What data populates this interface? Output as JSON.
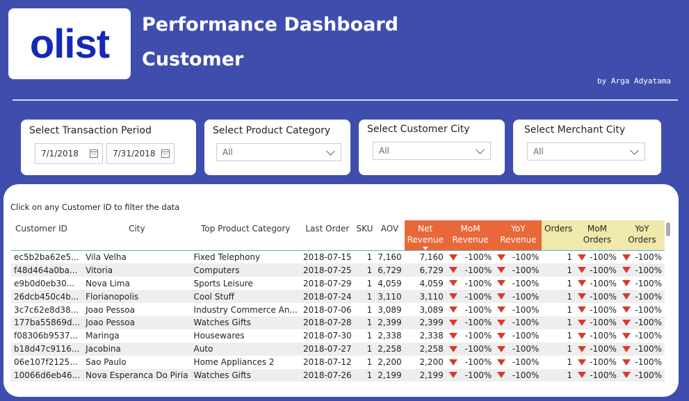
{
  "header": {
    "logo": "olist",
    "title": "Performance Dashboard",
    "subtitle": "Customer",
    "author": "by Arga Adyatama"
  },
  "filters": {
    "period": {
      "title": "Select Transaction Period",
      "start": "7/1/2018",
      "end": "7/31/2018"
    },
    "product_category": {
      "title": "Select Product Category",
      "value": "All"
    },
    "customer_city": {
      "title": "Select Customer City",
      "value": "All"
    },
    "merchant_city": {
      "title": "Select Merchant City",
      "value": "All"
    }
  },
  "table": {
    "hint": "Click on any Customer ID to filter the data",
    "columns": {
      "customer_id": "Customer ID",
      "city": "City",
      "top_product": "Top Product Category",
      "last_order": "Last Order",
      "sku": "SKU",
      "aov": "AOV",
      "net_revenue_1": "Net",
      "net_revenue_2": "Revenue",
      "mom_revenue_1": "MoM",
      "mom_revenue_2": "Revenue",
      "yoy_revenue_1": "YoY",
      "yoy_revenue_2": "Revenue",
      "orders": "Orders",
      "mom_orders_1": "MoM",
      "mom_orders_2": "Orders",
      "yoy_orders_1": "YoY",
      "yoy_orders_2": "Orders"
    },
    "rows": [
      {
        "id": "ec5b2ba62e5...",
        "city": "Vila Velha",
        "product": "Fixed Telephony",
        "last": "2018-07-15",
        "sku": "1",
        "aov": "7,160",
        "net": "7,160",
        "momr": "-100%",
        "yoyr": "-100%",
        "orders": "1",
        "momo": "-100%",
        "yoyo": "-100%"
      },
      {
        "id": "f48d464a0ba...",
        "city": "Vitoria",
        "product": "Computers",
        "last": "2018-07-25",
        "sku": "1",
        "aov": "6,729",
        "net": "6,729",
        "momr": "-100%",
        "yoyr": "-100%",
        "orders": "1",
        "momo": "-100%",
        "yoyo": "-100%"
      },
      {
        "id": "e9b0d0eb30...",
        "city": "Nova Lima",
        "product": "Sports Leisure",
        "last": "2018-07-29",
        "sku": "1",
        "aov": "4,059",
        "net": "4,059",
        "momr": "-100%",
        "yoyr": "-100%",
        "orders": "1",
        "momo": "-100%",
        "yoyo": "-100%"
      },
      {
        "id": "26dcb450c4b...",
        "city": "Florianopolis",
        "product": "Cool Stuff",
        "last": "2018-07-24",
        "sku": "1",
        "aov": "3,110",
        "net": "3,110",
        "momr": "-100%",
        "yoyr": "-100%",
        "orders": "1",
        "momo": "-100%",
        "yoyo": "-100%"
      },
      {
        "id": "3c7c62e8d38...",
        "city": "Joao Pessoa",
        "product": "Industry Commerce An...",
        "last": "2018-07-06",
        "sku": "1",
        "aov": "3,089",
        "net": "3,089",
        "momr": "-100%",
        "yoyr": "-100%",
        "orders": "1",
        "momo": "-100%",
        "yoyo": "-100%"
      },
      {
        "id": "177ba55869d...",
        "city": "Joao Pessoa",
        "product": "Watches Gifts",
        "last": "2018-07-28",
        "sku": "1",
        "aov": "2,399",
        "net": "2,399",
        "momr": "-100%",
        "yoyr": "-100%",
        "orders": "1",
        "momo": "-100%",
        "yoyo": "-100%"
      },
      {
        "id": "f08306b9537...",
        "city": "Maringa",
        "product": "Housewares",
        "last": "2018-07-30",
        "sku": "1",
        "aov": "2,338",
        "net": "2,338",
        "momr": "-100%",
        "yoyr": "-100%",
        "orders": "1",
        "momo": "-100%",
        "yoyo": "-100%"
      },
      {
        "id": "b18d47c9116...",
        "city": "Jacobina",
        "product": "Auto",
        "last": "2018-07-27",
        "sku": "1",
        "aov": "2,258",
        "net": "2,258",
        "momr": "-100%",
        "yoyr": "-100%",
        "orders": "1",
        "momo": "-100%",
        "yoyo": "-100%"
      },
      {
        "id": "06e107f2125...",
        "city": "Sao Paulo",
        "product": "Home Appliances 2",
        "last": "2018-07-12",
        "sku": "1",
        "aov": "2,200",
        "net": "2,200",
        "momr": "-100%",
        "yoyr": "-100%",
        "orders": "1",
        "momo": "-100%",
        "yoyo": "-100%"
      },
      {
        "id": "10066d6eb46...",
        "city": "Nova Esperanca Do Piria",
        "product": "Watches Gifts",
        "last": "2018-07-26",
        "sku": "1",
        "aov": "2,199",
        "net": "2,199",
        "momr": "-100%",
        "yoyr": "-100%",
        "orders": "1",
        "momo": "-100%",
        "yoyo": "-100%"
      }
    ]
  },
  "colors": {
    "background": "#3f4ead",
    "logo": "#1429b8",
    "revenue_header": "#e8683a",
    "orders_header": "#efe9ab",
    "down_indicator": "#d93a2b"
  }
}
